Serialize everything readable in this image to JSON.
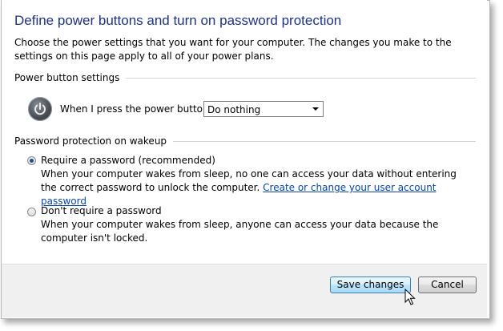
{
  "window": {
    "title": "Define power buttons and turn on password protection",
    "description": "Choose the power settings that you want for your computer. The changes you make to the settings on this page apply to all of your power plans."
  },
  "power_button_settings": {
    "heading": "Power button settings",
    "label": "When I press the power button:",
    "selected_value": "Do nothing",
    "icon": "power-icon"
  },
  "password_protection": {
    "heading": "Password protection on wakeup",
    "options": [
      {
        "label": "Require a password (recommended)",
        "checked": true,
        "description": "When your computer wakes from sleep, no one can access your data without entering the correct password to unlock the computer.",
        "link": "Create or change your user account password"
      },
      {
        "label": "Don't require a password",
        "checked": false,
        "description": "When your computer wakes from sleep, anyone can access your data because the computer isn't locked."
      }
    ]
  },
  "buttons": {
    "save_label": "Save changes",
    "cancel_label": "Cancel"
  },
  "colors": {
    "title": "#1e3287",
    "link": "#0645ad",
    "bottom_bar": "#f0f0f0"
  }
}
